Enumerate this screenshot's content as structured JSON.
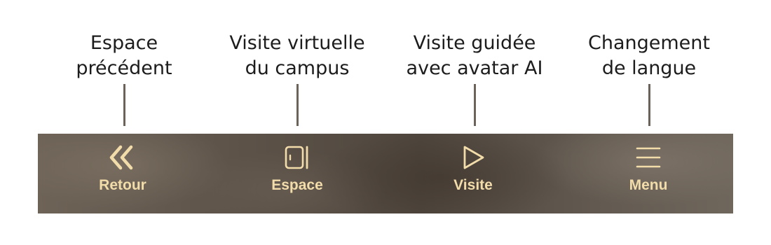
{
  "callouts": [
    {
      "line1": "Espace",
      "line2": "précédent"
    },
    {
      "line1": "Visite virtuelle",
      "line2": "du campus"
    },
    {
      "line1": "Visite guidée",
      "line2": "avec avatar AI"
    },
    {
      "line1": "Changement",
      "line2": "de langue"
    }
  ],
  "nav": {
    "items": [
      {
        "label": "Retour",
        "icon": "double-chevron-left-icon"
      },
      {
        "label": "Espace",
        "icon": "door-icon"
      },
      {
        "label": "Visite",
        "icon": "play-icon"
      },
      {
        "label": "Menu",
        "icon": "hamburger-menu-icon"
      }
    ]
  },
  "colors": {
    "label": "#f1dcaa",
    "icon": "#f1dcaa",
    "leader": "#6b6259",
    "callout_text": "#1c1c1c"
  }
}
